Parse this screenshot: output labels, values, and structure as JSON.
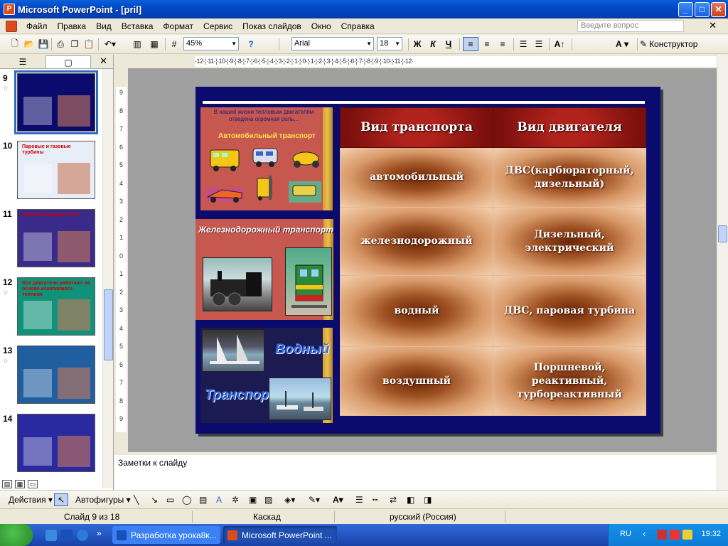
{
  "window": {
    "title": "Microsoft PowerPoint - [pril]",
    "app_icon": "powerpoint-icon"
  },
  "menu": {
    "items": [
      "Файл",
      "Правка",
      "Вид",
      "Вставка",
      "Формат",
      "Сервис",
      "Показ слайдов",
      "Окно",
      "Справка"
    ],
    "help_placeholder": "Введите вопрос"
  },
  "toolbar": {
    "zoom": "45%",
    "font": "Arial",
    "font_size": "18",
    "bold": "Ж",
    "italic": "К",
    "underline": "Ч",
    "design_button": "Конструктор",
    "font_color_glyph": "A"
  },
  "rulers": {
    "horizontal": "·12·¦·11·¦·10·¦·9·¦·8·¦·7·¦·6·¦·5·¦·4·¦·3·¦·2·¦·1·¦·0·¦·1·¦·2·¦·3·¦·4·¦·5·¦·6·¦·7·¦·8·¦·9·¦·10·¦·11·¦·12·",
    "vertical": [
      "9",
      "8",
      "7",
      "6",
      "5",
      "4",
      "3",
      "2",
      "1",
      "0",
      "1",
      "2",
      "3",
      "4",
      "5",
      "6",
      "7",
      "8",
      "9"
    ]
  },
  "slides_panel": {
    "thumbnails": [
      {
        "number": "9",
        "title": "",
        "bg": "#0b0b6e",
        "selected": true,
        "starred": true
      },
      {
        "number": "10",
        "title": "Паровые и газовые турбины",
        "bg": "#e8eef7",
        "selected": false,
        "starred": false
      },
      {
        "number": "11",
        "title": "Реактивный двигатель",
        "bg": "#3a2b8a",
        "selected": false,
        "starred": false
      },
      {
        "number": "12",
        "title": "Все двигатели работают на основе ископаемого топлива",
        "bg": "#10927a",
        "selected": false,
        "starred": true
      },
      {
        "number": "13",
        "title": "",
        "bg": "#1f5fa0",
        "selected": false,
        "starred": true
      },
      {
        "number": "14",
        "title": "",
        "bg": "#2a2aa0",
        "selected": false,
        "starred": false
      }
    ]
  },
  "slide": {
    "panel1_caption": "В нашей жизни тепловым двигателям отведена огромная роль...",
    "panel1_title": "Автомобильный транспорт",
    "panel2_title": "Железнодорожный транспорт",
    "panel3_word1": "Водный",
    "panel3_word2": "Транспорт",
    "table": {
      "headers": [
        "Вид транспорта",
        "Вид двигателя"
      ],
      "rows": [
        [
          "автомобильный",
          "ДВС(карбюраторный, дизельный)"
        ],
        [
          "железнодорожный",
          "Дизельный, электрический"
        ],
        [
          "водный",
          "ДВС, паровая турбина"
        ],
        [
          "воздушный",
          "Поршневой, реактивный, турбореактивный"
        ]
      ]
    }
  },
  "notes": {
    "placeholder": "Заметки к слайду"
  },
  "drawing_toolbar": {
    "actions": "Действия",
    "autoshapes": "Автофигуры"
  },
  "status": {
    "slide_position": "Слайд 9 из 18",
    "design": "Каскад",
    "language": "русский (Россия)"
  },
  "taskbar": {
    "tasks": [
      {
        "label": "Разработка урока8к...",
        "active": false
      },
      {
        "label": "Microsoft PowerPoint ...",
        "active": true
      }
    ],
    "tray_lang": "RU",
    "clock": "19:32"
  },
  "colors": {
    "accent": "#316ac5",
    "slide_bg": "#0b0b6e",
    "table_header": "#9a1812",
    "table_cell": "#d99a6a"
  }
}
